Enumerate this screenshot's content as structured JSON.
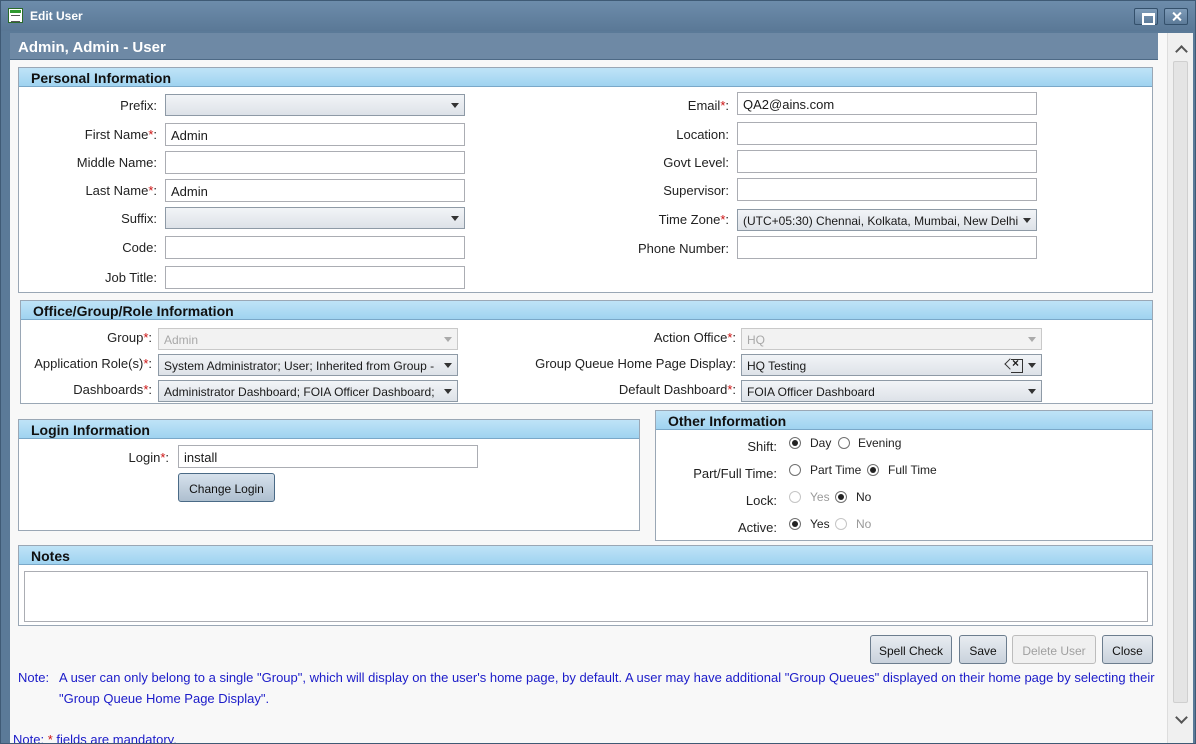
{
  "window": {
    "title": "Edit User"
  },
  "header": {
    "title": "Admin, Admin - User"
  },
  "personal": {
    "title": "Personal Information",
    "prefix_label": "Prefix:",
    "prefix_value": "",
    "first_name_label": "First Name",
    "first_name_value": "Admin",
    "middle_name_label": "Middle Name:",
    "middle_name_value": "",
    "last_name_label": "Last Name",
    "last_name_value": "Admin",
    "suffix_label": "Suffix:",
    "suffix_value": "",
    "code_label": "Code:",
    "code_value": "",
    "job_title_label": "Job Title:",
    "job_title_value": "",
    "email_label": "Email",
    "email_value": "QA2@ains.com",
    "location_label": "Location:",
    "location_value": "",
    "govt_level_label": "Govt Level:",
    "govt_level_value": "",
    "supervisor_label": "Supervisor:",
    "supervisor_value": "",
    "time_zone_label": "Time Zone",
    "time_zone_value": "(UTC+05:30) Chennai, Kolkata, Mumbai, New Delhi",
    "phone_label": "Phone Number:",
    "phone_value": ""
  },
  "office": {
    "title": "Office/Group/Role Information",
    "group_label": "Group",
    "group_value": "Admin",
    "app_roles_label": "Application Role(s)",
    "app_roles_value": "System Administrator; User; Inherited from Group -",
    "dashboards_label": "Dashboards",
    "dashboards_value": "Administrator Dashboard; FOIA Officer Dashboard;",
    "action_office_label": "Action Office",
    "action_office_value": "HQ",
    "gq_label": "Group Queue Home Page Display:",
    "gq_value": "HQ Testing",
    "default_dash_label": "Default Dashboard",
    "default_dash_value": "FOIA Officer Dashboard"
  },
  "login": {
    "title": "Login Information",
    "login_label": "Login",
    "login_value": "install",
    "change_login_label": "Change Login"
  },
  "other": {
    "title": "Other Information",
    "shift_label": "Shift:",
    "shift_day": "Day",
    "shift_evening": "Evening",
    "ptft_label": "Part/Full Time:",
    "part_time": "Part Time",
    "full_time": "Full Time",
    "lock_label": "Lock:",
    "lock_yes": "Yes",
    "lock_no": "No",
    "active_label": "Active:",
    "active_yes": "Yes",
    "active_no": "No"
  },
  "notes": {
    "title": "Notes",
    "value": ""
  },
  "actions": {
    "spell_check": "Spell Check",
    "save": "Save",
    "delete_user": "Delete User",
    "close": "Close"
  },
  "footer": {
    "note_prefix": "Note:",
    "note_body": "A user can only belong to a single \"Group\", which will display on the user's home page, by default. A user may have additional \"Group Queues\" displayed on their home page by selecting their \"Group Queue Home Page Display\".",
    "mandatory_prefix": "Note:",
    "mandatory_star": "*",
    "mandatory_suffix": "fields are mandatory."
  }
}
